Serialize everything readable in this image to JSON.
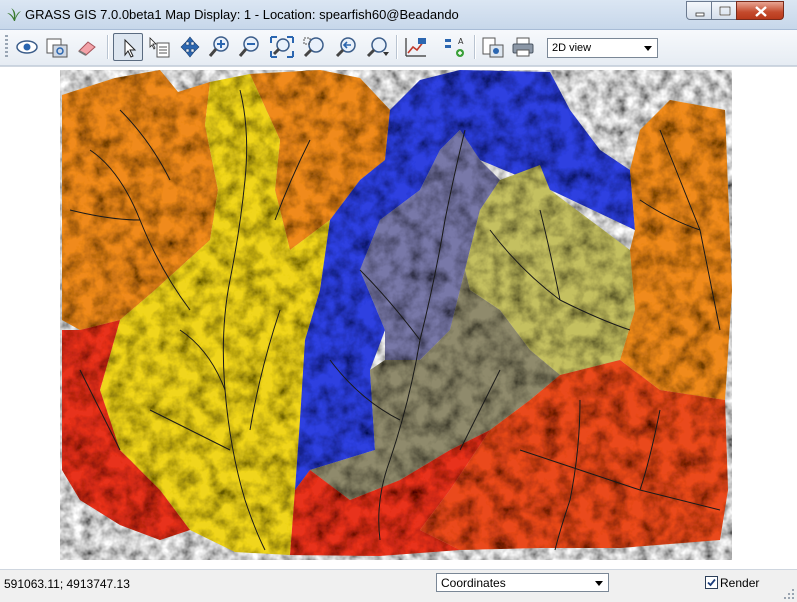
{
  "window": {
    "title": "GRASS GIS 7.0.0beta1 Map Display: 1  - Location: spearfish60@Beadando"
  },
  "toolbar": {
    "buttons": [
      {
        "name": "display-map-icon"
      },
      {
        "name": "render-map-icon"
      },
      {
        "name": "erase-display-icon"
      },
      {
        "name": "pointer-icon",
        "active": true
      },
      {
        "name": "query-icon"
      },
      {
        "name": "pan-icon"
      },
      {
        "name": "zoom-in-icon"
      },
      {
        "name": "zoom-out-icon"
      },
      {
        "name": "zoom-extent-icon"
      },
      {
        "name": "zoom-region-icon"
      },
      {
        "name": "zoom-back-icon"
      },
      {
        "name": "zoom-menu-icon"
      },
      {
        "name": "analyze-icon"
      },
      {
        "name": "overlay-icon"
      },
      {
        "name": "save-image-icon"
      },
      {
        "name": "print-icon"
      }
    ],
    "view_mode": "2D view"
  },
  "map": {
    "colors": {
      "orange": "#f08a1c",
      "yellow": "#f0d51e",
      "blue": "#2f3fe0",
      "grayblue": "#7878a8",
      "khaki": "#c4c060",
      "olive": "#8f8a6c",
      "red": "#e8301c",
      "redorange": "#ea4a1e"
    }
  },
  "statusbar": {
    "coordinates": "591063.11; 4913747.13",
    "mode": "Coordinates",
    "render_label": "Render",
    "render_checked": true
  }
}
